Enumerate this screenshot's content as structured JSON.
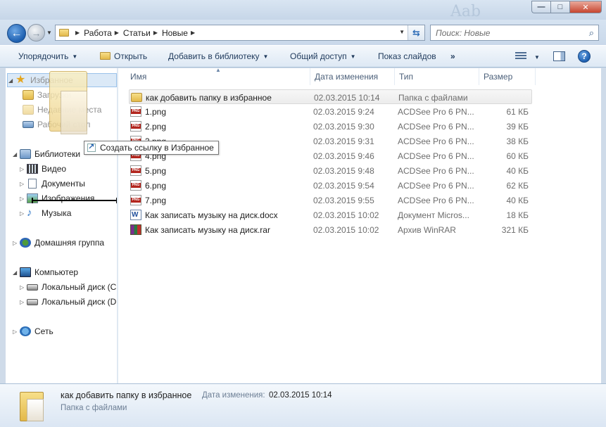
{
  "window": {
    "controls": {
      "minimize_label": "—",
      "maximize_label": "□",
      "close_label": "✕"
    },
    "background_ghost_text": "Aab"
  },
  "nav": {
    "back_icon": "back-arrow-icon",
    "forward_icon": "forward-arrow-icon",
    "breadcrumb": [
      "Работа",
      "Статьи",
      "Новые"
    ],
    "search_placeholder": "Поиск: Новые"
  },
  "toolbar": {
    "organize": "Упорядочить",
    "open": "Открыть",
    "add_to_library": "Добавить в библиотеку",
    "share": "Общий доступ",
    "slideshow": "Показ слайдов",
    "more": "»"
  },
  "navpane": {
    "favorites": "Избранное",
    "downloads": "Загрузки",
    "recent": "Недавние места",
    "desktop": "Рабочий стол",
    "libraries": "Библиотеки",
    "video": "Видео",
    "documents": "Документы",
    "images": "Изображения",
    "music": "Музыка",
    "homegroup": "Домашняя группа",
    "computer": "Компьютер",
    "disk_c": "Локальный диск (C",
    "disk_d": "Локальный диск (D",
    "network": "Сеть"
  },
  "drag": {
    "tooltip": "Создать ссылку в Избранное"
  },
  "columns": {
    "name": "Имя",
    "date": "Дата изменения",
    "type": "Тип",
    "size": "Размер"
  },
  "files": [
    {
      "name": "как добавить папку в избранное",
      "date": "02.03.2015 10:14",
      "type": "Папка с файлами",
      "size": "",
      "icon": "folder-icon"
    },
    {
      "name": "1.png",
      "date": "02.03.2015 9:24",
      "type": "ACDSee Pro 6 PN...",
      "size": "61 КБ",
      "icon": "png-file-icon"
    },
    {
      "name": "2.png",
      "date": "02.03.2015 9:30",
      "type": "ACDSee Pro 6 PN...",
      "size": "39 КБ",
      "icon": "png-file-icon"
    },
    {
      "name": "3.png",
      "date": "02.03.2015 9:31",
      "type": "ACDSee Pro 6 PN...",
      "size": "38 КБ",
      "icon": "png-file-icon"
    },
    {
      "name": "4.png",
      "date": "02.03.2015 9:46",
      "type": "ACDSee Pro 6 PN...",
      "size": "60 КБ",
      "icon": "png-file-icon"
    },
    {
      "name": "5.png",
      "date": "02.03.2015 9:48",
      "type": "ACDSee Pro 6 PN...",
      "size": "40 КБ",
      "icon": "png-file-icon"
    },
    {
      "name": "6.png",
      "date": "02.03.2015 9:54",
      "type": "ACDSee Pro 6 PN...",
      "size": "62 КБ",
      "icon": "png-file-icon"
    },
    {
      "name": "7.png",
      "date": "02.03.2015 9:55",
      "type": "ACDSee Pro 6 PN...",
      "size": "40 КБ",
      "icon": "png-file-icon"
    },
    {
      "name": "Как записать музыку на диск.docx",
      "date": "02.03.2015 10:02",
      "type": "Документ Micros...",
      "size": "18 КБ",
      "icon": "docx-file-icon"
    },
    {
      "name": "Как записать музыку на диск.rar",
      "date": "02.03.2015 10:02",
      "type": "Архив WinRAR",
      "size": "321 КБ",
      "icon": "rar-file-icon"
    }
  ],
  "details": {
    "name": "как добавить папку в избранное",
    "date_label": "Дата изменения:",
    "date": "02.03.2015 10:14",
    "type": "Папка с файлами"
  }
}
